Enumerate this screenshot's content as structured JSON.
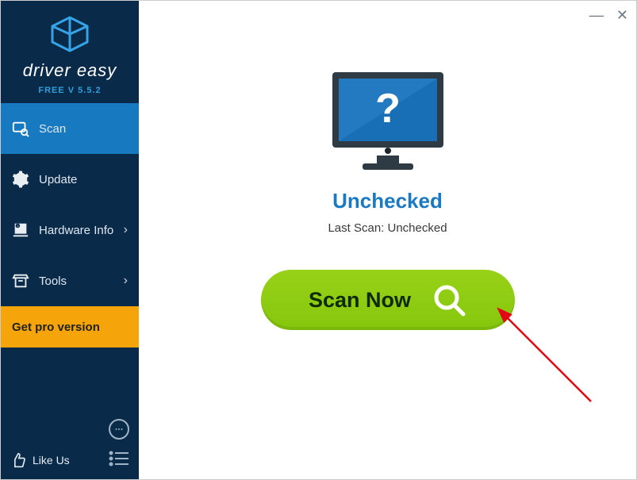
{
  "brand": {
    "name": "driver easy",
    "version": "FREE V 5.5.2"
  },
  "sidebar": {
    "items": [
      {
        "label": "Scan"
      },
      {
        "label": "Update"
      },
      {
        "label": "Hardware Info"
      },
      {
        "label": "Tools"
      }
    ],
    "pro": {
      "label": "Get pro version"
    },
    "like": {
      "label": "Like Us"
    }
  },
  "main": {
    "status_title": "Unchecked",
    "status_sub": "Last Scan: Unchecked",
    "scan_button": "Scan Now"
  }
}
